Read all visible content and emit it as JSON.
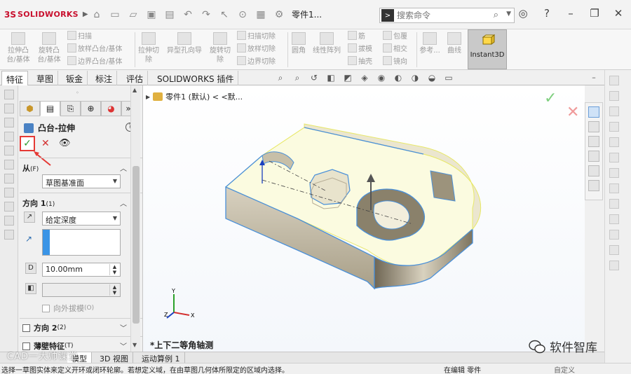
{
  "titlebar": {
    "logo_prefix": "3S",
    "logo_name": "SOLIDWORKS",
    "doc_title": "零件1...",
    "search_placeholder": "搜索命令"
  },
  "command_manager": {
    "extrude_boss": "拉伸凸台/基体",
    "revolve_boss": "旋转凸台/基体",
    "sweep": "扫描",
    "loft": "放样凸台/基体",
    "boundary": "边界凸台/基体",
    "extrude_cut": "拉伸切除",
    "hole_wizard": "异型孔向导",
    "revolve_cut": "旋转切除",
    "sweep_cut": "扫描切除",
    "loft_cut": "放样切除",
    "boundary_cut": "边界切除",
    "fillet": "圆角",
    "linear_pattern": "线性阵列",
    "rib": "筋",
    "draft": "拔模",
    "shell": "抽壳",
    "wrap": "包覆",
    "intersect": "相交",
    "mirror": "镜向",
    "ref_geometry": "参考...",
    "curves": "曲线",
    "instant3d": "Instant3D"
  },
  "tabs": [
    "特征",
    "草图",
    "钣金",
    "标注",
    "评估",
    "SOLIDWORKS 插件"
  ],
  "property_manager": {
    "title": "凸台-拉伸",
    "from_label": "从",
    "from_key": "(F)",
    "from_value": "草图基准面",
    "dir1_label": "方向 1",
    "dir1_key": "(1)",
    "end_condition": "给定深度",
    "depth": "10.00mm",
    "draft_outward": "向外拔模",
    "draft_outward_key": "(O)",
    "dir2_label": "方向 2",
    "dir2_key": "(2)",
    "thin_label": "薄壁特征",
    "thin_key": "(T)"
  },
  "graphics": {
    "tree_item": "零件1 (默认) < <默...",
    "view_label": "*上下二等角轴测",
    "triad": {
      "x": "X",
      "y": "Y",
      "z": "Z"
    }
  },
  "bottom_tabs": [
    "模型",
    "3D 视图",
    "运动算例 1"
  ],
  "status": {
    "message": "选择一草图实体来定义开环或闭环轮廓。若想定义域，在由草图几何体所限定的区域内选择。",
    "mode": "在编辑 零件",
    "custom": "自定义"
  },
  "watermarks": {
    "right": "软件智库",
    "left": "CAD一大帅课堂"
  },
  "colors": {
    "accent_red": "#e53935",
    "ok_green": "#2e9b2e",
    "selection_blue": "#3a94e6",
    "preview_yellow": "#f0f05a"
  }
}
